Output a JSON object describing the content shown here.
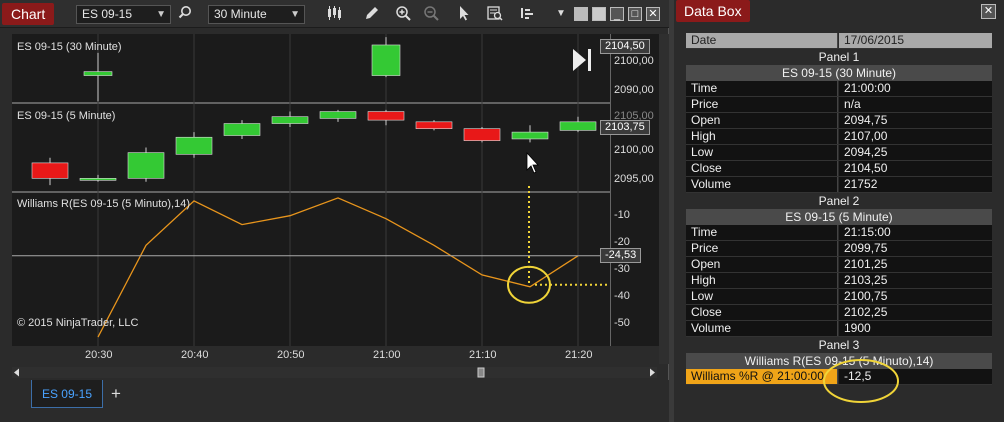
{
  "chart_window": {
    "title": "Chart",
    "instrument": "ES 09-15",
    "interval": "30 Minute",
    "tab_label": "ES 09-15",
    "add_tab_label": "+"
  },
  "panels": {
    "panel1_label": "ES 09-15 (30 Minute)",
    "panel2_label": "ES 09-15 (5 Minute)",
    "panel3_label": "Williams R(ES 09-15 (5 Minuto),14)",
    "copyright": "© 2015 NinjaTrader, LLC",
    "p1_ticks": [
      "2100,00",
      "2090,00"
    ],
    "p2_ticks": [
      "2105,00",
      "2100,00",
      "2095,00"
    ],
    "p3_ticks": [
      "-10",
      "-20",
      "-30",
      "-40",
      "-50"
    ],
    "p1_price_tag": "2104,50",
    "p2_price_tag": "2103,75",
    "p3_price_tag": "-24,53",
    "time_labels": [
      "20:30",
      "20:40",
      "20:50",
      "21:00",
      "21:10",
      "21:20"
    ]
  },
  "chart_data": [
    {
      "type": "candlestick",
      "title": "ES 09-15 (30 Minute)",
      "ylim": [
        2086,
        2108
      ],
      "bars": [
        {
          "time": "20:30",
          "open": 2094.75,
          "high": 2102.0,
          "low": 2086.5,
          "close": 2096.0
        },
        {
          "time": "21:00",
          "open": 2094.75,
          "high": 2107.0,
          "low": 2094.25,
          "close": 2104.5
        }
      ]
    },
    {
      "type": "candlestick",
      "title": "ES 09-15 (5 Minute)",
      "ylim": [
        2093.5,
        2106.5
      ],
      "bars": [
        {
          "time": "20:25",
          "open": 2097.75,
          "high": 2098.5,
          "low": 2094.5,
          "close": 2095.5
        },
        {
          "time": "20:30",
          "open": 2095.25,
          "high": 2096.0,
          "low": 2095.0,
          "close": 2095.5
        },
        {
          "time": "20:35",
          "open": 2095.5,
          "high": 2100.0,
          "low": 2095.0,
          "close": 2099.25
        },
        {
          "time": "20:40",
          "open": 2099.0,
          "high": 2102.25,
          "low": 2098.5,
          "close": 2101.5
        },
        {
          "time": "20:45",
          "open": 2101.75,
          "high": 2104.0,
          "low": 2101.25,
          "close": 2103.5
        },
        {
          "time": "20:50",
          "open": 2103.5,
          "high": 2105.25,
          "low": 2103.0,
          "close": 2104.5
        },
        {
          "time": "20:55",
          "open": 2104.25,
          "high": 2105.5,
          "low": 2103.75,
          "close": 2105.25
        },
        {
          "time": "21:00",
          "open": 2105.25,
          "high": 2105.5,
          "low": 2103.25,
          "close": 2104.0
        },
        {
          "time": "21:05",
          "open": 2103.75,
          "high": 2104.0,
          "low": 2102.5,
          "close": 2102.75
        },
        {
          "time": "21:10",
          "open": 2102.75,
          "high": 2103.0,
          "low": 2100.75,
          "close": 2101.0
        },
        {
          "time": "21:15",
          "open": 2101.25,
          "high": 2103.25,
          "low": 2100.75,
          "close": 2102.25
        },
        {
          "time": "21:20",
          "open": 2102.5,
          "high": 2104.5,
          "low": 2102.25,
          "close": 2103.75
        }
      ]
    },
    {
      "type": "line",
      "title": "Williams R(ES 09-15 (5 Minuto),14)",
      "ylim": [
        -55,
        -3
      ],
      "x": [
        "20:30",
        "20:35",
        "20:40",
        "20:45",
        "20:50",
        "20:55",
        "21:00",
        "21:05",
        "21:10",
        "21:15",
        "21:20"
      ],
      "values": [
        -52,
        -21,
        -6,
        -14,
        -11,
        -5,
        -12,
        -21,
        -31,
        -35,
        -24.53
      ],
      "color": "#e8951c"
    }
  ],
  "databox": {
    "title": "Data Box",
    "date_label": "Date",
    "date_value": "17/06/2015",
    "panel1_header": "Panel 1",
    "panel1_series": "ES 09-15 (30 Minute)",
    "panel1_rows": [
      {
        "name": "Time",
        "value": "21:00:00"
      },
      {
        "name": "Price",
        "value": "n/a"
      },
      {
        "name": "Open",
        "value": "2094,75"
      },
      {
        "name": "High",
        "value": "2107,00"
      },
      {
        "name": "Low",
        "value": "2094,25"
      },
      {
        "name": "Close",
        "value": "2104,50"
      },
      {
        "name": "Volume",
        "value": "21752"
      }
    ],
    "panel2_header": "Panel 2",
    "panel2_series": "ES 09-15 (5 Minute)",
    "panel2_rows": [
      {
        "name": "Time",
        "value": "21:15:00"
      },
      {
        "name": "Price",
        "value": "2099,75"
      },
      {
        "name": "Open",
        "value": "2101,25"
      },
      {
        "name": "High",
        "value": "2103,25"
      },
      {
        "name": "Low",
        "value": "2100,75"
      },
      {
        "name": "Close",
        "value": "2102,25"
      },
      {
        "name": "Volume",
        "value": "1900"
      }
    ],
    "panel3_header": "Panel 3",
    "panel3_series": "Williams R(ES 09-15 (5 Minuto),14)",
    "wr_name": "Williams %R @ 21:00:00",
    "wr_value": "-12,5"
  },
  "colors": {
    "up": "#34c934",
    "down": "#e81818",
    "line": "#e8951c",
    "highlight": "#f0d438",
    "accent": "#8b1a1a"
  }
}
